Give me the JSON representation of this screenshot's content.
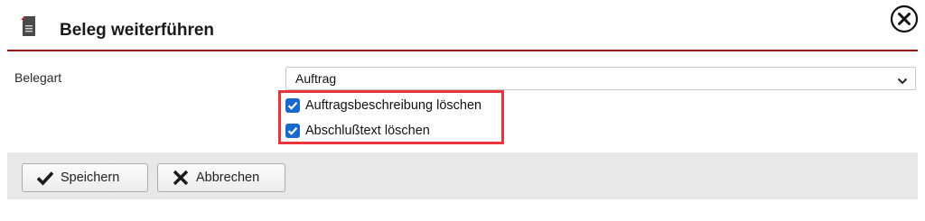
{
  "dialog": {
    "title": "Beleg weiterführen",
    "close_icon": "close-circle-icon",
    "header_icon": "document-icon"
  },
  "form": {
    "belegart": {
      "label": "Belegart",
      "value": "Auftrag"
    },
    "options": [
      {
        "label": "Auftragsbeschreibung löschen",
        "checked": true
      },
      {
        "label": "Abschlußtext löschen",
        "checked": true
      }
    ]
  },
  "footer": {
    "save_label": "Speichern",
    "cancel_label": "Abbrechen"
  },
  "colors": {
    "accent_rule": "#a01818",
    "highlight": "#e8343c",
    "checkbox": "#1868d0"
  }
}
